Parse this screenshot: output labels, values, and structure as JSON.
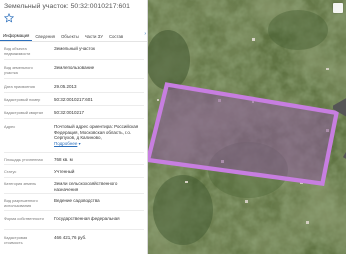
{
  "title": "Земельный участок: 50:32:0010217:601",
  "tabs": [
    {
      "label": "Информация",
      "active": true
    },
    {
      "label": "Сведения",
      "active": false
    },
    {
      "label": "Объекты",
      "active": false
    },
    {
      "label": "Части ЗУ",
      "active": false
    },
    {
      "label": "Состав",
      "active": false
    }
  ],
  "tab_next_icon": "chevron-right-icon",
  "info": [
    {
      "label": "Вид объекта недвижимости",
      "value": "Земельный участок"
    },
    {
      "label": "Вид земельного участка",
      "value": "Землепользование"
    },
    {
      "label": "Дата присвоения",
      "value": "29.05.2013"
    },
    {
      "label": "Кадастровый номер",
      "value": "50:32:0010217:601"
    },
    {
      "label": "Кадастровый квартал",
      "value": "50:32:0010217"
    },
    {
      "label": "Адрес",
      "value": "Почтовый адрес ориентира: Российская Федерация, Московская область, г.о. Серпухов, д Калиново,",
      "link": "Подробнее"
    },
    {
      "label": "Площадь уточненная",
      "value": "768 кв. м"
    },
    {
      "label": "Статус",
      "value": "Учтенный"
    },
    {
      "label": "Категория земель",
      "value": "Земли сельскохозяйственного назначения"
    },
    {
      "label": "Вид разрешенного использования",
      "value": "Ведение садоводства"
    },
    {
      "label": "Форма собственности",
      "value": "Государственная федеральная"
    },
    {
      "label": "Кадастровая стоимость",
      "value": "466 421,76 руб."
    }
  ],
  "map": {
    "parcel_fill": "#8a5a9b",
    "parcel_stroke": "#c77ee0",
    "controls": [
      "layers-icon",
      "zoom-in-icon",
      "zoom-out-icon"
    ]
  },
  "colors": {
    "accent": "#2a6ebb",
    "star": "#2a6ebb"
  }
}
